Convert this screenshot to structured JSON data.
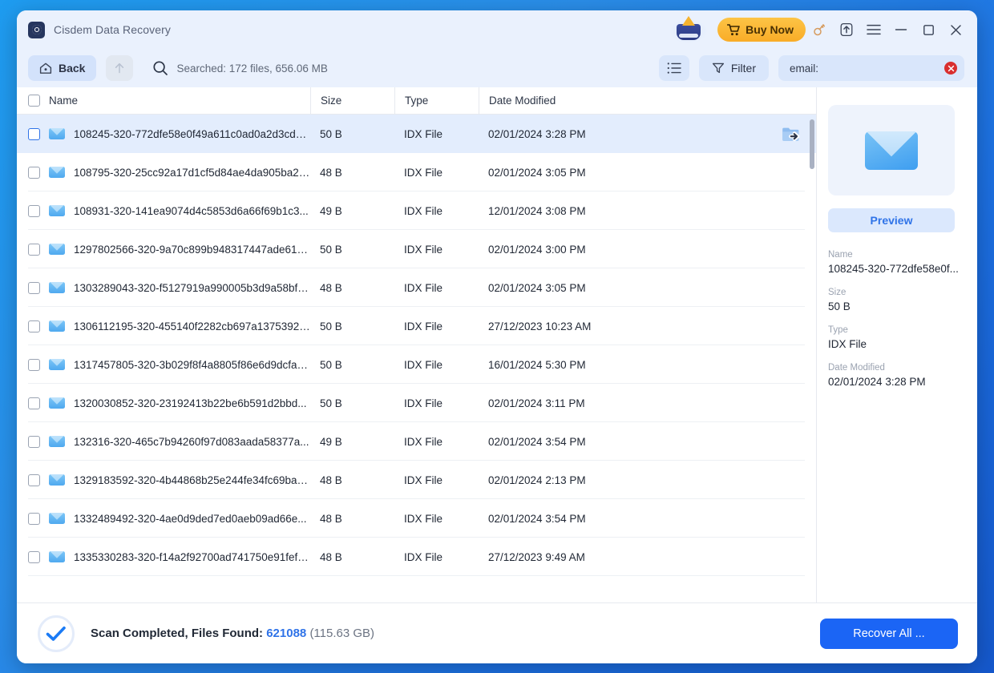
{
  "titlebar": {
    "app_name": "Cisdem Data Recovery",
    "buy_now": "Buy Now",
    "icons": {
      "logo": "hard-disk-logo",
      "vip": "vip-crown-icon",
      "cart": "cart-icon",
      "key": "key-icon",
      "upload": "upload-icon",
      "menu": "hamburger-menu-icon",
      "minimize": "minimize-icon",
      "maximize": "maximize-icon",
      "close": "close-icon"
    }
  },
  "toolbar": {
    "back_label": "Back",
    "up_label": "",
    "search_status": "Searched: 172 files, 656.06 MB",
    "filter_label": "Filter",
    "search_value": "email:",
    "search_placeholder": "Search"
  },
  "table": {
    "columns": [
      "Name",
      "Size",
      "Type",
      "Date Modified"
    ],
    "rows": [
      {
        "name": "108245-320-772dfe58e0f49a611c0ad0a2d3cd3...",
        "size": "50 B",
        "type": "IDX File",
        "date": "02/01/2024 3:28 PM",
        "selected": true
      },
      {
        "name": "108795-320-25cc92a17d1cf5d84ae4da905ba28...",
        "size": "48 B",
        "type": "IDX File",
        "date": "02/01/2024 3:05 PM",
        "selected": false
      },
      {
        "name": "108931-320-141ea9074d4c5853d6a66f69b1c3...",
        "size": "49 B",
        "type": "IDX File",
        "date": "12/01/2024 3:08 PM",
        "selected": false
      },
      {
        "name": "1297802566-320-9a70c899b948317447ade61a...",
        "size": "50 B",
        "type": "IDX File",
        "date": "02/01/2024 3:00 PM",
        "selected": false
      },
      {
        "name": "1303289043-320-f5127919a990005b3d9a58bf9...",
        "size": "48 B",
        "type": "IDX File",
        "date": "02/01/2024 3:05 PM",
        "selected": false
      },
      {
        "name": "1306112195-320-455140f2282cb697a13753923...",
        "size": "50 B",
        "type": "IDX File",
        "date": "27/12/2023 10:23 AM",
        "selected": false
      },
      {
        "name": "1317457805-320-3b029f8f4a8805f86e6d9dcfac...",
        "size": "50 B",
        "type": "IDX File",
        "date": "16/01/2024 5:30 PM",
        "selected": false
      },
      {
        "name": "1320030852-320-23192413b22be6b591d2bbd...",
        "size": "50 B",
        "type": "IDX File",
        "date": "02/01/2024 3:11 PM",
        "selected": false
      },
      {
        "name": "132316-320-465c7b94260f97d083aada58377a...",
        "size": "49 B",
        "type": "IDX File",
        "date": "02/01/2024 3:54 PM",
        "selected": false
      },
      {
        "name": "1329183592-320-4b44868b25e244fe34fc69bae...",
        "size": "48 B",
        "type": "IDX File",
        "date": "02/01/2024 2:13 PM",
        "selected": false
      },
      {
        "name": "1332489492-320-4ae0d9ded7ed0aeb09ad66e...",
        "size": "48 B",
        "type": "IDX File",
        "date": "02/01/2024 3:54 PM",
        "selected": false
      },
      {
        "name": "1335330283-320-f14a2f92700ad741750e91fef4...",
        "size": "48 B",
        "type": "IDX File",
        "date": "27/12/2023 9:49 AM",
        "selected": false
      }
    ]
  },
  "detail": {
    "preview_label": "Preview",
    "fields": [
      {
        "label": "Name",
        "value": "108245-320-772dfe58e0f..."
      },
      {
        "label": "Size",
        "value": "50 B"
      },
      {
        "label": "Type",
        "value": "IDX File"
      },
      {
        "label": "Date Modified",
        "value": "02/01/2024 3:28 PM"
      }
    ]
  },
  "footer": {
    "status_prefix": "Scan Completed, Files Found:",
    "status_count": "621088",
    "status_size": "(115.63 GB)",
    "recover_label": "Recover All ..."
  },
  "colors": {
    "accent": "#1b65f5",
    "link": "#2f73e8",
    "buy_now": "#f9ac27",
    "chrome": "#eaf1fd",
    "selection": "#e3edfd",
    "clear": "#d92f2f"
  }
}
